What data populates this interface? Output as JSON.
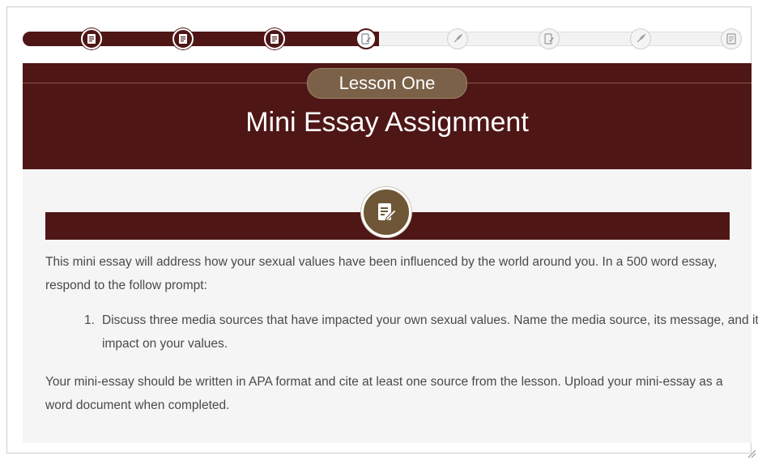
{
  "progress": {
    "steps": [
      {
        "state": "done",
        "icon": "document-icon"
      },
      {
        "state": "done",
        "icon": "document-icon"
      },
      {
        "state": "done",
        "icon": "document-icon"
      },
      {
        "state": "current",
        "icon": "edit-document-icon"
      },
      {
        "state": "todo",
        "icon": "rocket-icon"
      },
      {
        "state": "todo",
        "icon": "edit-document-icon"
      },
      {
        "state": "todo",
        "icon": "rocket-icon"
      },
      {
        "state": "todo",
        "icon": "document-icon"
      }
    ],
    "completed_fraction": 0.5
  },
  "banner": {
    "lesson_label": "Lesson One",
    "title": "Mini Essay Assignment"
  },
  "content": {
    "section_icon": "edit-document-icon",
    "intro": "This mini essay will address how your sexual values have been influenced by the world around you. In a 500 word essay, respond to the follow prompt:",
    "list": [
      {
        "number": "1.",
        "text": "Discuss three media sources that have impacted your own sexual values. Name the media source, its message, and its impact on your values."
      }
    ],
    "closing": "Your mini-essay should be written in APA format and cite at least one source from the lesson. Upload your mini-essay as a word document when completed."
  },
  "colors": {
    "maroon": "#4f1616",
    "gold": "#7a6148",
    "text": "#4a4a4a"
  }
}
